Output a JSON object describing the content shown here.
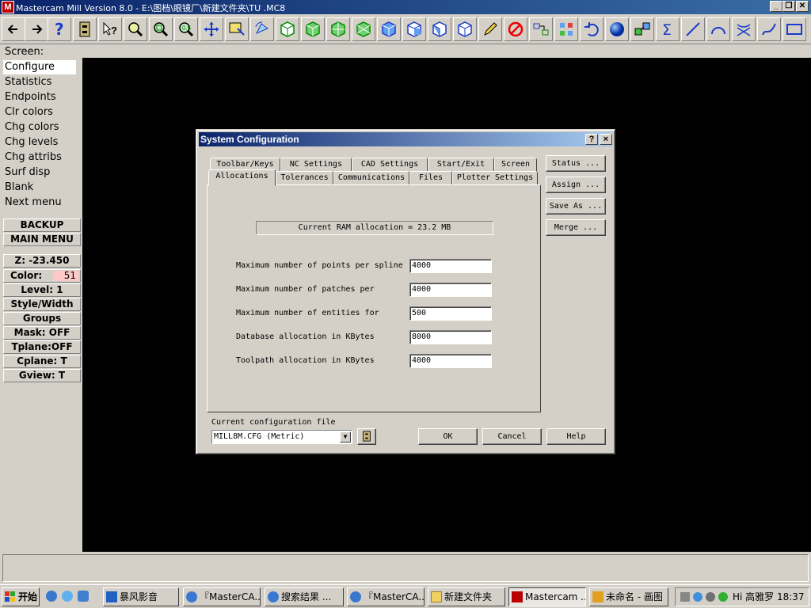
{
  "window": {
    "title": "Mastercam Mill Version 8.0 - E:\\图档\\眼镜厂\\新建文件夹\\TU .MC8",
    "app_icon": "mastercam-icon",
    "controls": [
      "minimize",
      "maximize",
      "close"
    ]
  },
  "toolbar": {
    "icons": [
      "back-arrow-icon",
      "forward-arrow-icon",
      "help-icon",
      "file-cabinet-icon",
      "whats-this-icon",
      "zoom-icon",
      "zoom-window-icon",
      "unzoom-icon",
      "fit-icon",
      "pan-icon",
      "select-icon",
      "rotate-view-icon",
      "cube-green-1-icon",
      "cube-green-2-icon",
      "cube-green-3-icon",
      "cube-green-4-icon",
      "cube-blue-1-icon",
      "cube-blue-2-icon",
      "cube-blue-3-icon",
      "cube-blue-4-icon",
      "pencil-icon",
      "no-shading-icon",
      "move-icon",
      "transform-icon",
      "undo-icon",
      "sphere-icon",
      "array-icon",
      "sigma-icon",
      "line-icon",
      "arc-icon",
      "trim-icon",
      "spline-icon",
      "rectangle-icon"
    ]
  },
  "screen_label": "Screen:",
  "menu": {
    "items": [
      {
        "label": "Configure",
        "selected": true
      },
      {
        "label": "Statistics"
      },
      {
        "label": "Endpoints"
      },
      {
        "label": "Clr colors"
      },
      {
        "label": "Chg colors"
      },
      {
        "label": "Chg levels"
      },
      {
        "label": "Chg attribs"
      },
      {
        "label": "Surf disp"
      },
      {
        "label": "Blank"
      },
      {
        "label": "Next menu"
      }
    ],
    "backup": "BACKUP",
    "main_menu": "MAIN MENU"
  },
  "status": {
    "z": "Z: -23.450",
    "color_label": "Color:",
    "color_value": "51",
    "level": "Level:  1",
    "style_width": "Style/Width",
    "groups": "Groups",
    "mask": "Mask:  OFF",
    "tplane": "Tplane:OFF",
    "cplane": "Cplane:  T",
    "gview": "Gview:   T"
  },
  "dialog": {
    "title": "System Configuration",
    "help_btn": "?",
    "close_btn": "×",
    "tabs_back": [
      "Toolbar/Keys",
      "NC Settings",
      "CAD Settings",
      "Start/Exit",
      "Screen"
    ],
    "tabs_front": [
      "Allocations",
      "Tolerances",
      "Communications",
      "Files",
      "Plotter Settings"
    ],
    "active_tab": "Allocations",
    "ram_text": "Current RAM allocation = 23.2 MB",
    "fields": [
      {
        "label": "Maximum number of points per spline",
        "value": "4000"
      },
      {
        "label": "Maximum number of patches per",
        "value": "4000"
      },
      {
        "label": "Maximum number of entities for",
        "value": "500"
      },
      {
        "label": "Database allocation in KBytes",
        "value": "8000"
      },
      {
        "label": "Toolpath allocation in KBytes",
        "value": "4000"
      }
    ],
    "side_buttons": [
      "Status ...",
      "Assign ...",
      "Save As ...",
      "Merge ..."
    ],
    "config_file_label": "Current configuration file",
    "config_file_value": "MILL8M.CFG (Metric)",
    "ok": "OK",
    "cancel": "Cancel",
    "help": "Help"
  },
  "taskbar": {
    "start": "开始",
    "items": [
      {
        "label": "暴风影音",
        "active": false
      },
      {
        "label": "『MasterCA...",
        "active": false
      },
      {
        "label": "搜索结果 ...",
        "active": false
      },
      {
        "label": "『MasterCA...",
        "active": false
      },
      {
        "label": "新建文件夹",
        "active": false
      },
      {
        "label": "Mastercam ...",
        "active": true
      },
      {
        "label": "未命名 - 画图",
        "active": false
      }
    ],
    "tray_text": "Hi 高雅罗 18:37"
  }
}
